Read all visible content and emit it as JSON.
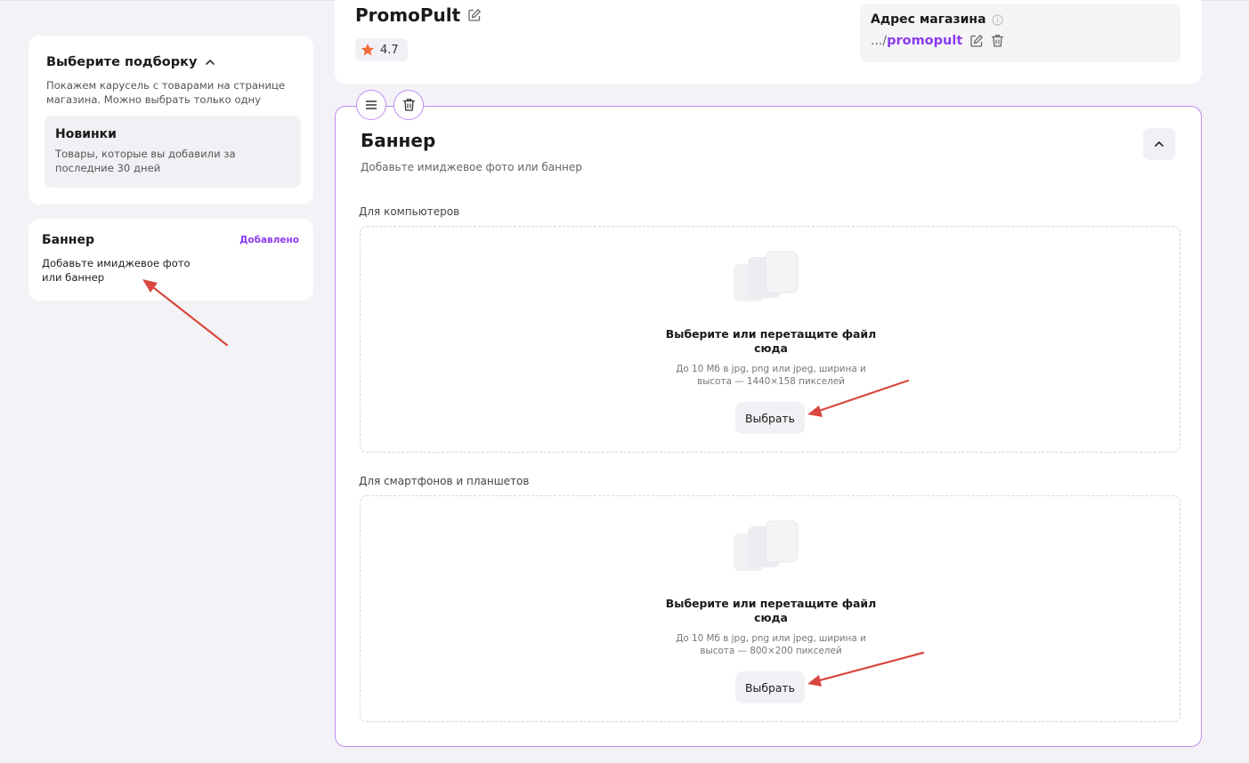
{
  "collections": {
    "title": "Выберите подборку",
    "description": "Покажем карусель с товарами на странице магазина. Можно выбрать только одну",
    "option": {
      "title": "Новинки",
      "description": "Товары, которые вы добавили за последние 30 дней"
    }
  },
  "banner_block": {
    "title": "Баннер",
    "badge": "Добавлено",
    "description": "Добавьте имиджевое фото или баннер"
  },
  "store": {
    "name": "PromoPult",
    "rating": "4.7",
    "address_label": "Адрес магазина",
    "address_prefix": ".../",
    "address_slug": "promopult"
  },
  "editor": {
    "title": "Баннер",
    "description": "Добавьте имиджевое фото или баннер",
    "desktop": {
      "label": "Для компьютеров",
      "drop_title": "Выберите или перетащите файл сюда",
      "hint": "До 10 Мб в jpg, png или jpeg, ширина и высота — 1440×158 пикселей",
      "button": "Выбрать"
    },
    "mobile": {
      "label": "Для смартфонов и планшетов",
      "drop_title": "Выберите или перетащите файл сюда",
      "hint": "До 10 Мб в jpg, png или jpeg, ширина и высота — 800×200 пикселей",
      "button": "Выбрать"
    }
  },
  "colors": {
    "accent": "#8b3bf0",
    "border_accent": "#c08cf3",
    "arrow": "#d9473f",
    "star": "#f26b3a"
  },
  "icons": [
    "chevron-up-icon",
    "edit-icon",
    "star-icon",
    "info-icon",
    "trash-icon",
    "drag-handle-icon",
    "image-placeholder-icon",
    "annotation-arrow"
  ]
}
